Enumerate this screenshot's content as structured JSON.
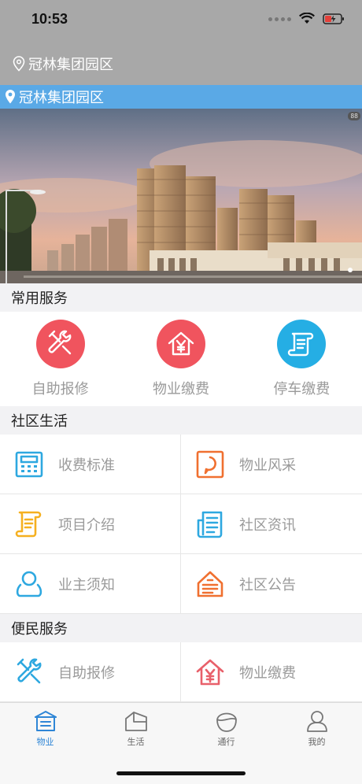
{
  "status_bar": {
    "time": "10:53"
  },
  "nav": {
    "location": "冠林集团园区"
  },
  "location_bar": {
    "text": "冠林集团园区"
  },
  "banner": {
    "badge": "88"
  },
  "sections": {
    "common_services": {
      "title": "常用服务",
      "items": [
        {
          "label": "自助报修",
          "icon": "wrench-icon",
          "color": "#f0545e"
        },
        {
          "label": "物业缴费",
          "icon": "house-yen-icon",
          "color": "#f0545e"
        },
        {
          "label": "停车缴费",
          "icon": "scroll-icon",
          "color": "#25aee4"
        }
      ]
    },
    "community_life": {
      "title": "社区生活",
      "items": [
        {
          "label": "收费标准",
          "icon": "calculator-icon",
          "color": "#2ea8e0"
        },
        {
          "label": "物业风采",
          "icon": "chat-frame-icon",
          "color": "#f07030"
        },
        {
          "label": "项目介绍",
          "icon": "scroll-icon",
          "color": "#f5b020"
        },
        {
          "label": "社区资讯",
          "icon": "document-list-icon",
          "color": "#2ea8e0"
        },
        {
          "label": "业主须知",
          "icon": "person-icon",
          "color": "#2ea8e0"
        },
        {
          "label": "社区公告",
          "icon": "notice-icon",
          "color": "#f07030"
        }
      ]
    },
    "convenience": {
      "title": "便民服务",
      "items": [
        {
          "label": "自助报修",
          "icon": "wrench-icon",
          "color": "#2ea8e0"
        },
        {
          "label": "物业缴费",
          "icon": "house-yen-icon",
          "color": "#e8606a"
        }
      ]
    }
  },
  "tabbar": {
    "items": [
      {
        "label": "物业",
        "icon": "property-icon",
        "active": true
      },
      {
        "label": "生活",
        "icon": "life-house-icon",
        "active": false
      },
      {
        "label": "通行",
        "icon": "passage-icon",
        "active": false
      },
      {
        "label": "我的",
        "icon": "profile-icon",
        "active": false
      }
    ]
  },
  "colors": {
    "accent": "#5aa9e6",
    "tab_active": "#2f86d6",
    "nav_bg": "#a8a8a8"
  }
}
